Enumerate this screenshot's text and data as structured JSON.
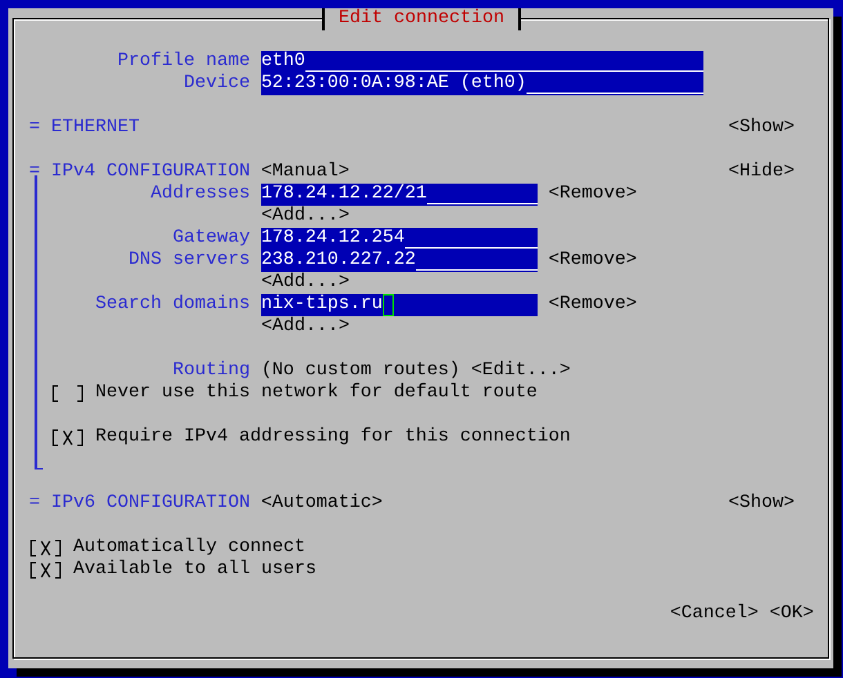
{
  "dialog": {
    "title": "Edit connection"
  },
  "fields": [
    {
      "label": "Profile name",
      "value": "eth0",
      "cursor": false
    },
    {
      "label": "Device",
      "value": "52:23:00:0A:98:AE (eth0)",
      "cursor": false
    }
  ],
  "ethernet": {
    "marker": "=",
    "heading": "ETHERNET",
    "toggle": "<Show>"
  },
  "ipv4": {
    "marker": "=",
    "heading": "IPv4 CONFIGURATION",
    "mode": "<Manual>",
    "toggle": "<Hide>",
    "rows": [
      {
        "kind": "field",
        "label": "Addresses",
        "value": "178.24.12.22/21",
        "cursor": false,
        "remove": "<Remove>"
      },
      {
        "kind": "add",
        "button": "<Add...>"
      },
      {
        "kind": "field",
        "label": "Gateway",
        "value": "178.24.12.254",
        "cursor": false
      },
      {
        "kind": "field",
        "label": "DNS servers",
        "value": "238.210.227.22",
        "cursor": false,
        "remove": "<Remove>"
      },
      {
        "kind": "add",
        "button": "<Add...>"
      },
      {
        "kind": "field",
        "label": "Search domains",
        "value": "nix-tips.ru",
        "cursor": true,
        "remove": "<Remove>"
      },
      {
        "kind": "add",
        "button": "<Add...>"
      },
      {
        "kind": "blank"
      },
      {
        "kind": "routing",
        "label": "Routing",
        "value": "(No custom routes)",
        "button": "<Edit...>"
      },
      {
        "kind": "check",
        "label": "Never use this network for default route",
        "checked": false
      },
      {
        "kind": "blank"
      },
      {
        "kind": "check",
        "label": "Require IPv4 addressing for this connection",
        "checked": true
      },
      {
        "kind": "blank"
      }
    ]
  },
  "ipv6": {
    "marker": "=",
    "heading": "IPv6 CONFIGURATION",
    "mode": "<Automatic>",
    "toggle": "<Show>"
  },
  "options": [
    {
      "label": "Automatically connect",
      "checked": true
    },
    {
      "label": "Available to all users",
      "checked": true
    }
  ],
  "buttons": [
    "<Cancel>",
    "<OK>"
  ]
}
